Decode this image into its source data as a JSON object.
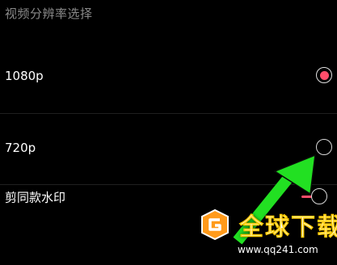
{
  "section_title": "视频分辨率选择",
  "options": [
    {
      "label": "1080p",
      "selected": true
    },
    {
      "label": "720p",
      "selected": false
    }
  ],
  "watermark_setting": {
    "label": "剪同款水印"
  },
  "colors": {
    "accent": "#ff4d6a",
    "arrow": "#22e022",
    "divider": "#1f1f1f"
  },
  "overlay_watermark": {
    "text": "全球下载",
    "url": "www.qq241.com"
  }
}
